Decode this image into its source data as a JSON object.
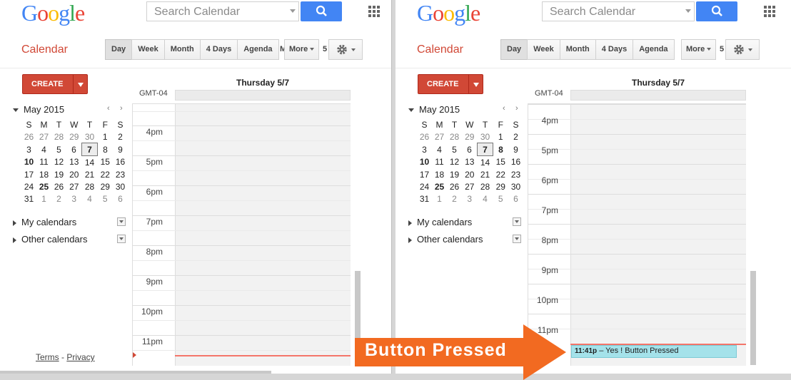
{
  "header": {
    "logo_letters": [
      {
        "ch": "G",
        "color": "#4285f4"
      },
      {
        "ch": "o",
        "color": "#ea4335"
      },
      {
        "ch": "o",
        "color": "#fbbc05"
      },
      {
        "ch": "g",
        "color": "#4285f4"
      },
      {
        "ch": "l",
        "color": "#34a853"
      },
      {
        "ch": "e",
        "color": "#ea4335"
      }
    ],
    "search_placeholder": "Search Calendar",
    "search_icon": "search-icon",
    "apps_icon": "apps-grid-icon"
  },
  "toolbar": {
    "calendar_label": "Calendar",
    "views": [
      "Day",
      "Week",
      "Month",
      "4 Days",
      "Agenda"
    ],
    "active_view": "Day",
    "cut_text_left": "M",
    "cut_text_right": "5",
    "more_label": "More",
    "settings_icon": "gear-icon"
  },
  "sidebar": {
    "create_label": "CREATE",
    "mini_calendar": {
      "title": "May 2015",
      "prev": "‹",
      "next": "›",
      "weekdays": [
        "S",
        "M",
        "T",
        "W",
        "T",
        "F",
        "S"
      ],
      "weeks": [
        [
          "26",
          "27",
          "28",
          "29",
          "30",
          "1",
          "2"
        ],
        [
          "3",
          "4",
          "5",
          "6",
          "7",
          "8",
          "9"
        ],
        [
          "10",
          "11",
          "12",
          "13",
          "14",
          "15",
          "16"
        ],
        [
          "17",
          "18",
          "19",
          "20",
          "21",
          "22",
          "23"
        ],
        [
          "24",
          "25",
          "26",
          "27",
          "28",
          "29",
          "30"
        ],
        [
          "31",
          "1",
          "2",
          "3",
          "4",
          "5",
          "6"
        ]
      ]
    },
    "my_calendars": "My calendars",
    "other_calendars": "Other calendars",
    "footer": {
      "terms": "Terms",
      "sep": " - ",
      "privacy": "Privacy"
    }
  },
  "day_view": {
    "date_header": "Thursday 5/7",
    "timezone": "GMT-04",
    "left_hours": [
      "4pm",
      "5pm",
      "6pm",
      "7pm",
      "8pm",
      "9pm",
      "10pm",
      "11pm"
    ],
    "right_hours": [
      "4pm",
      "5pm",
      "6pm",
      "7pm",
      "8pm",
      "9pm",
      "10pm",
      "11pm"
    ]
  },
  "event": {
    "time": "11:41p",
    "dash": " – ",
    "title": "Yes ! Button Pressed",
    "color": "#a4e2ea"
  },
  "annotation": {
    "text": "Button Pressed",
    "color": "#f26a21"
  }
}
